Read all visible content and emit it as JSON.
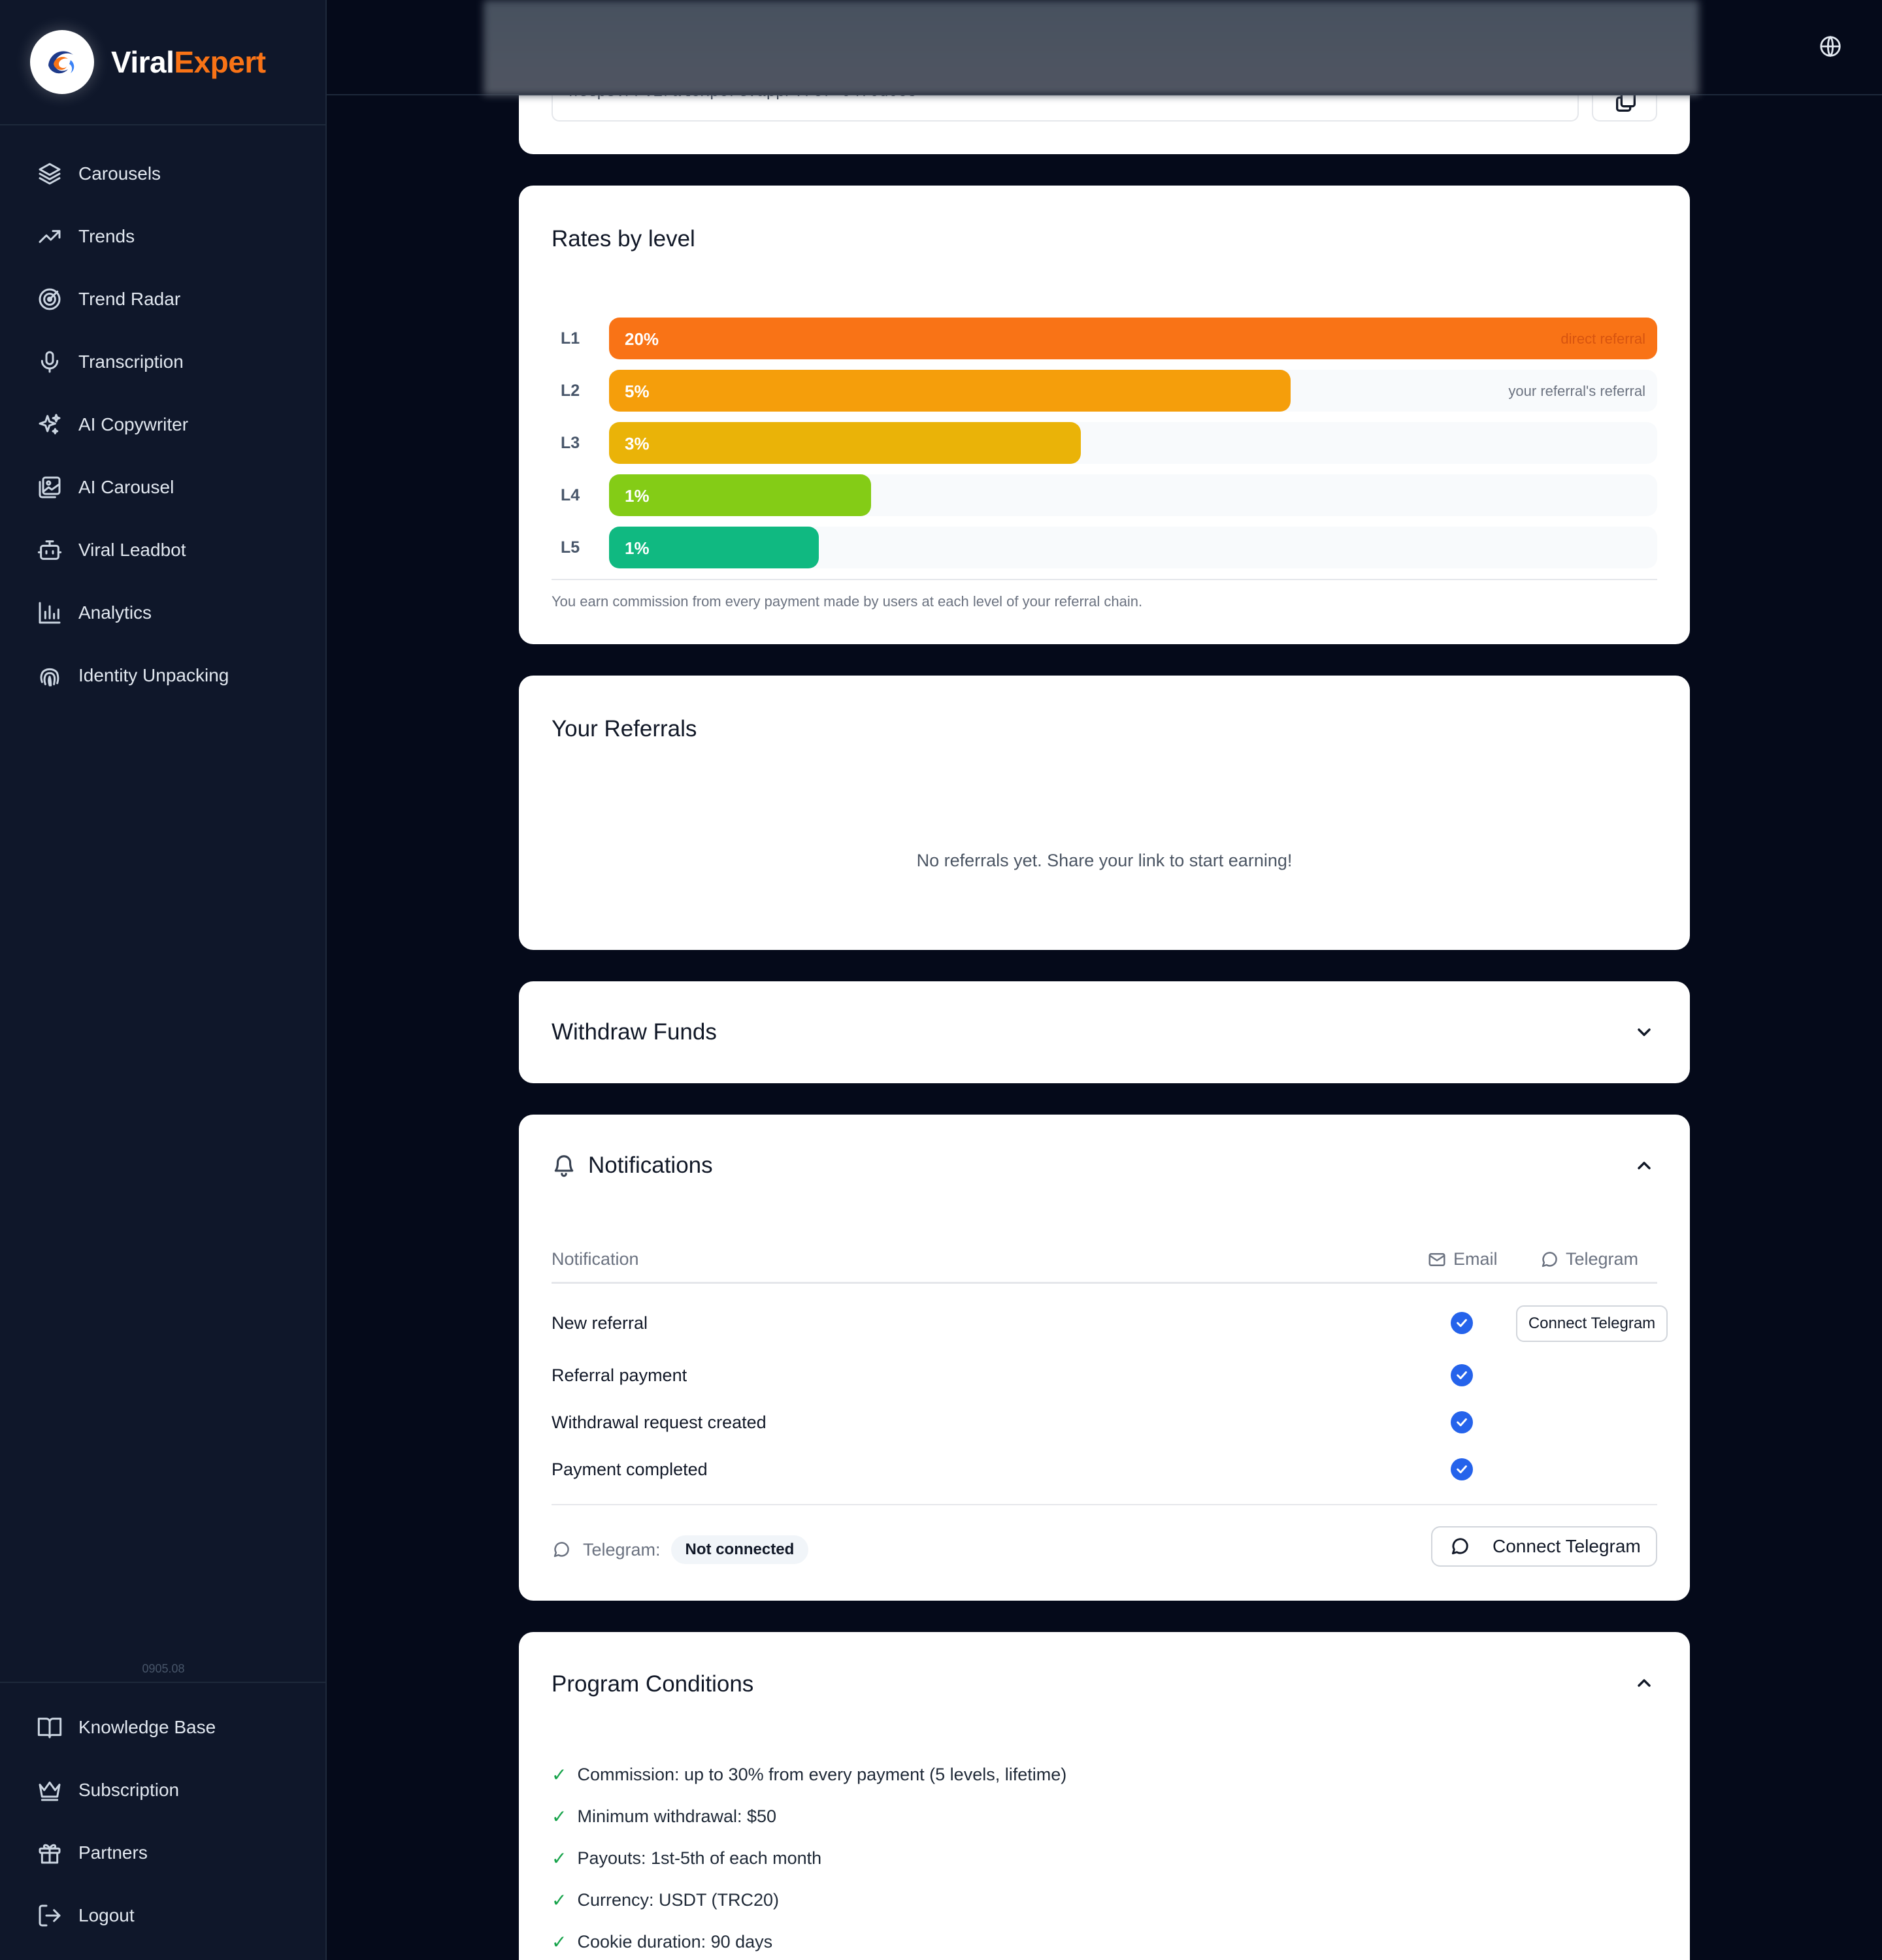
{
  "brand": {
    "name_part1": "Viral",
    "name_part2": "Expert"
  },
  "sidebar": {
    "items": [
      {
        "label": "Carousels",
        "icon": "layers-icon"
      },
      {
        "label": "Trends",
        "icon": "trending-up-icon"
      },
      {
        "label": "Trend Radar",
        "icon": "radar-icon"
      },
      {
        "label": "Transcription",
        "icon": "microphone-icon"
      },
      {
        "label": "AI Copywriter",
        "icon": "sparkles-icon"
      },
      {
        "label": "AI Carousel",
        "icon": "images-icon"
      },
      {
        "label": "Viral Leadbot",
        "icon": "bot-icon"
      },
      {
        "label": "Analytics",
        "icon": "bar-chart-icon"
      },
      {
        "label": "Identity Unpacking",
        "icon": "fingerprint-icon"
      }
    ],
    "version": "0905.08",
    "bottom_items": [
      {
        "label": "Knowledge Base",
        "icon": "book-icon"
      },
      {
        "label": "Subscription",
        "icon": "crown-icon"
      },
      {
        "label": "Partners",
        "icon": "gift-icon"
      },
      {
        "label": "Logout",
        "icon": "logout-icon"
      }
    ]
  },
  "referral_link": {
    "value": "https://viralexpert.app/?ref=0470d0c8"
  },
  "rates": {
    "title": "Rates by level",
    "levels": [
      {
        "level": "L1",
        "percent": "20%",
        "fill": 1.0,
        "color": "#f97316",
        "note": "direct referral"
      },
      {
        "level": "L2",
        "percent": "5%",
        "fill": 0.65,
        "color": "#f59e0b",
        "note": "your referral's referral"
      },
      {
        "level": "L3",
        "percent": "3%",
        "fill": 0.45,
        "color": "#eab308",
        "note": ""
      },
      {
        "level": "L4",
        "percent": "1%",
        "fill": 0.25,
        "color": "#84cc16",
        "note": ""
      },
      {
        "level": "L5",
        "percent": "1%",
        "fill": 0.2,
        "color": "#10b981",
        "note": ""
      }
    ],
    "footnote": "You earn commission from every payment made by users at each level of your referral chain."
  },
  "referrals": {
    "title": "Your Referrals",
    "empty_text": "No referrals yet. Share your link to start earning!"
  },
  "withdraw": {
    "title": "Withdraw Funds"
  },
  "notifications": {
    "title": "Notifications",
    "col_notification": "Notification",
    "col_email": "Email",
    "col_telegram": "Telegram",
    "rows": [
      {
        "label": "New referral",
        "email": true
      },
      {
        "label": "Referral payment",
        "email": true
      },
      {
        "label": "Withdrawal request created",
        "email": true
      },
      {
        "label": "Payment completed",
        "email": true
      }
    ],
    "row_connect_button": "Connect Telegram",
    "telegram_label": "Telegram:",
    "telegram_status": "Not connected",
    "connect_button": "Connect Telegram"
  },
  "program": {
    "title": "Program Conditions",
    "conditions": [
      "Commission: up to 30% from every payment (5 levels, lifetime)",
      "Minimum withdrawal: $50",
      "Payouts: 1st-5th of each month",
      "Currency: USDT (TRC20)",
      "Cookie duration: 90 days"
    ]
  }
}
